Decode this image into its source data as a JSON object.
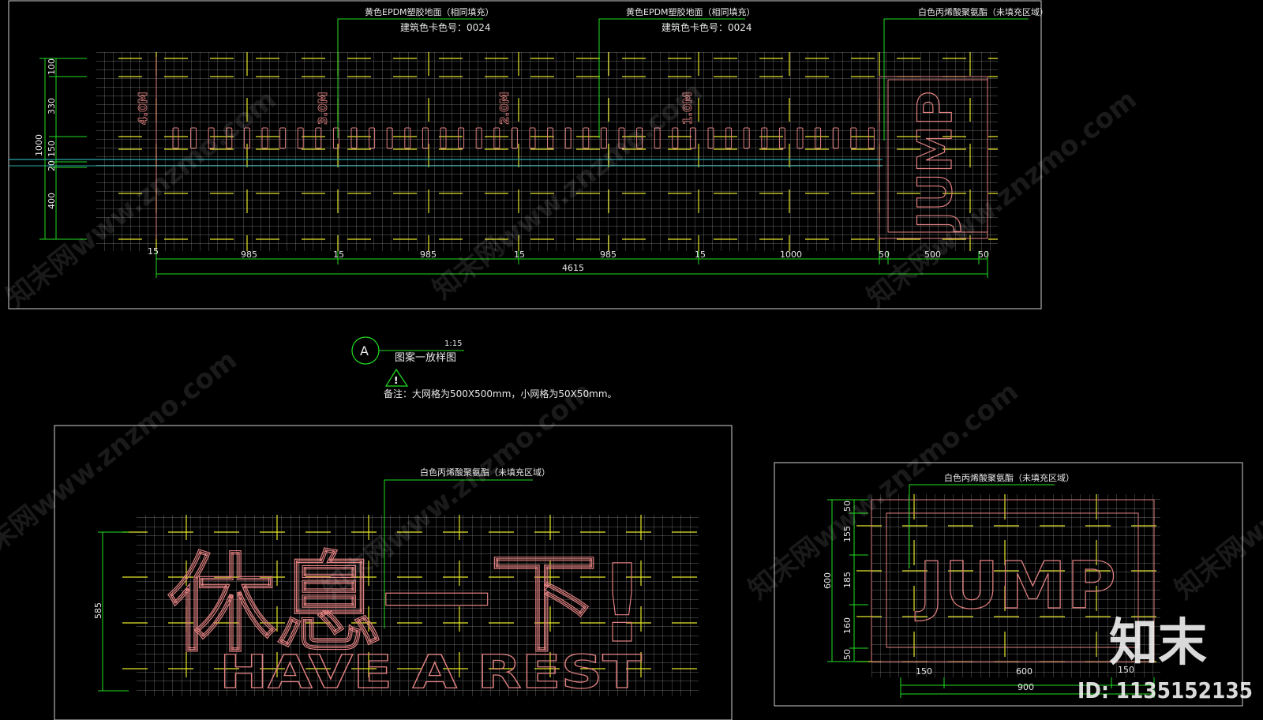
{
  "top_panel": {
    "callouts": [
      {
        "line1": "黄色EPDM塑胶地面（相同填充）",
        "line2": "建筑色卡色号：0024"
      },
      {
        "line1": "黄色EPDM塑胶地面（相同填充）",
        "line2": "建筑色卡色号：0024"
      },
      {
        "line1": "白色丙烯酸聚氨酯（未填充区域）",
        "line2": ""
      }
    ],
    "distance_marks": [
      "4.0M",
      "3.0M",
      "2.0M",
      "1.0M"
    ],
    "word": "JUMP",
    "left_dims": [
      "100",
      "330",
      "150",
      "20",
      "400"
    ],
    "left_total": "1000",
    "bottom_dims": [
      "15",
      "985",
      "15",
      "985",
      "15",
      "985",
      "15",
      "1000",
      "50",
      "500",
      "50"
    ],
    "bottom_total": "4615"
  },
  "section_tag": {
    "letter": "A",
    "scale": "1:15",
    "title": "图案一放样图",
    "warning_glyph": "!",
    "note": "备注：大网格为500X500mm，小网格为50X50mm。"
  },
  "bottom_left_panel": {
    "callout": "白色丙烯酸聚氨酯（未填充区域）",
    "chinese_text": "休息一下!",
    "english_text": "HAVE A REST",
    "height_dim": "585"
  },
  "bottom_right_panel": {
    "callout": "白色丙烯酸聚氨酯（未填充区域）",
    "word": "JUMP",
    "left_dims": [
      "50",
      "155",
      "185",
      "160",
      "50"
    ],
    "left_total": "600",
    "bottom_dims": [
      "150",
      "600",
      "150"
    ],
    "bottom_total": "900"
  },
  "watermark": {
    "text": "知末网www.znzmo.com",
    "brand": "知末",
    "id_label": "ID: 1135152135"
  },
  "colors": {
    "grid": "#8a8a8a",
    "yellow": "#e6e62a",
    "green": "#22dd22",
    "red_outline": "#e08080",
    "cyan": "#2aa6a6",
    "frame": "#cfcfcf"
  }
}
